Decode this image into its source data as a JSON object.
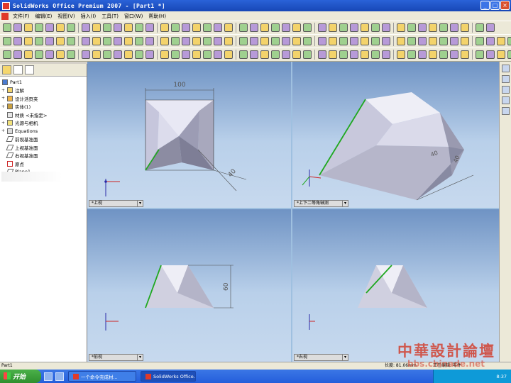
{
  "window": {
    "title": "SolidWorks Office Premium 2007 - [Part1 *]"
  },
  "menu": [
    "文件(F)",
    "编辑(E)",
    "视图(V)",
    "插入(I)",
    "工具(T)",
    "窗口(W)",
    "帮助(H)"
  ],
  "feature_manager": {
    "root": "Part1",
    "items": [
      "注解",
      "设计活页夹",
      "实体(1)",
      "材质 <未指定>",
      "光源与相机",
      "Equations",
      "前视基准面",
      "上视基准面",
      "右视基准面",
      "原点",
      "Plane1"
    ]
  },
  "viewports": {
    "top": {
      "label": "*上视",
      "dim_top": "100",
      "dim_side": "40"
    },
    "iso": {
      "label": "*上下二等角轴测",
      "dim_a": "40",
      "dim_b": "40"
    },
    "front": {
      "label": "*前视",
      "dim": "60"
    },
    "right": {
      "label": "*右视"
    }
  },
  "status": {
    "left": "Part1",
    "length": "长度: 81.06mm",
    "mode": "正在编辑: 零件"
  },
  "taskbar": {
    "start": "开始",
    "task1": "一个命令完成材...",
    "task2": "SolidWorks Office...",
    "clock": "8:37"
  },
  "watermark": {
    "line1": "中華設計論壇",
    "line2": "bbs.chinade.net"
  },
  "colors": {
    "viewport_top": "#6f93c4",
    "viewport_bottom": "#c7d9ee",
    "edge_highlight": "#1fa81f",
    "dimension": "#4d4d4d"
  }
}
